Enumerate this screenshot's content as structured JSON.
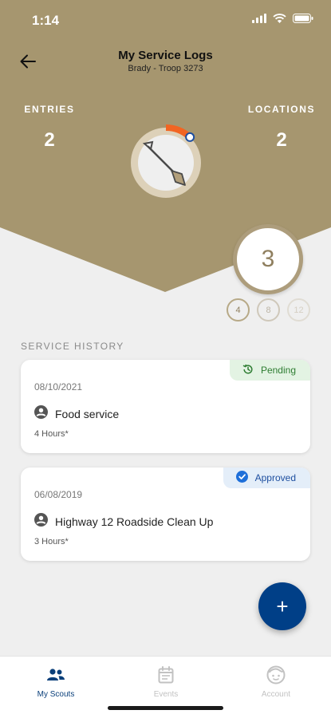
{
  "status_bar": {
    "time": "1:14"
  },
  "header": {
    "title": "My Service Logs",
    "subtitle": "Brady - Troop 3273",
    "stats": {
      "entries_label": "ENTRIES",
      "entries_value": "2",
      "locations_label": "LOCATIONS",
      "locations_value": "2"
    },
    "progress_fraction": 0.12,
    "colors": {
      "header_bg": "#a6966f",
      "progress_accent": "#f26522",
      "progress_track": "#ddd1b9"
    }
  },
  "rank": {
    "current": "3",
    "milestones": [
      "4",
      "8",
      "12"
    ]
  },
  "service_history": {
    "title": "SERVICE HISTORY",
    "entries": [
      {
        "status": "Pending",
        "date": "08/10/2021",
        "name": "Food service",
        "hours": "4 Hours*"
      },
      {
        "status": "Approved",
        "date": "06/08/2019",
        "name": "Highway 12 Roadside Clean Up",
        "hours": "3 Hours*"
      }
    ]
  },
  "fab": {
    "label": "+"
  },
  "tabs": [
    {
      "label": "My Scouts",
      "icon": "people-icon",
      "active": true
    },
    {
      "label": "Events",
      "icon": "calendar-icon",
      "active": false
    },
    {
      "label": "Account",
      "icon": "account-face-icon",
      "active": false
    }
  ]
}
